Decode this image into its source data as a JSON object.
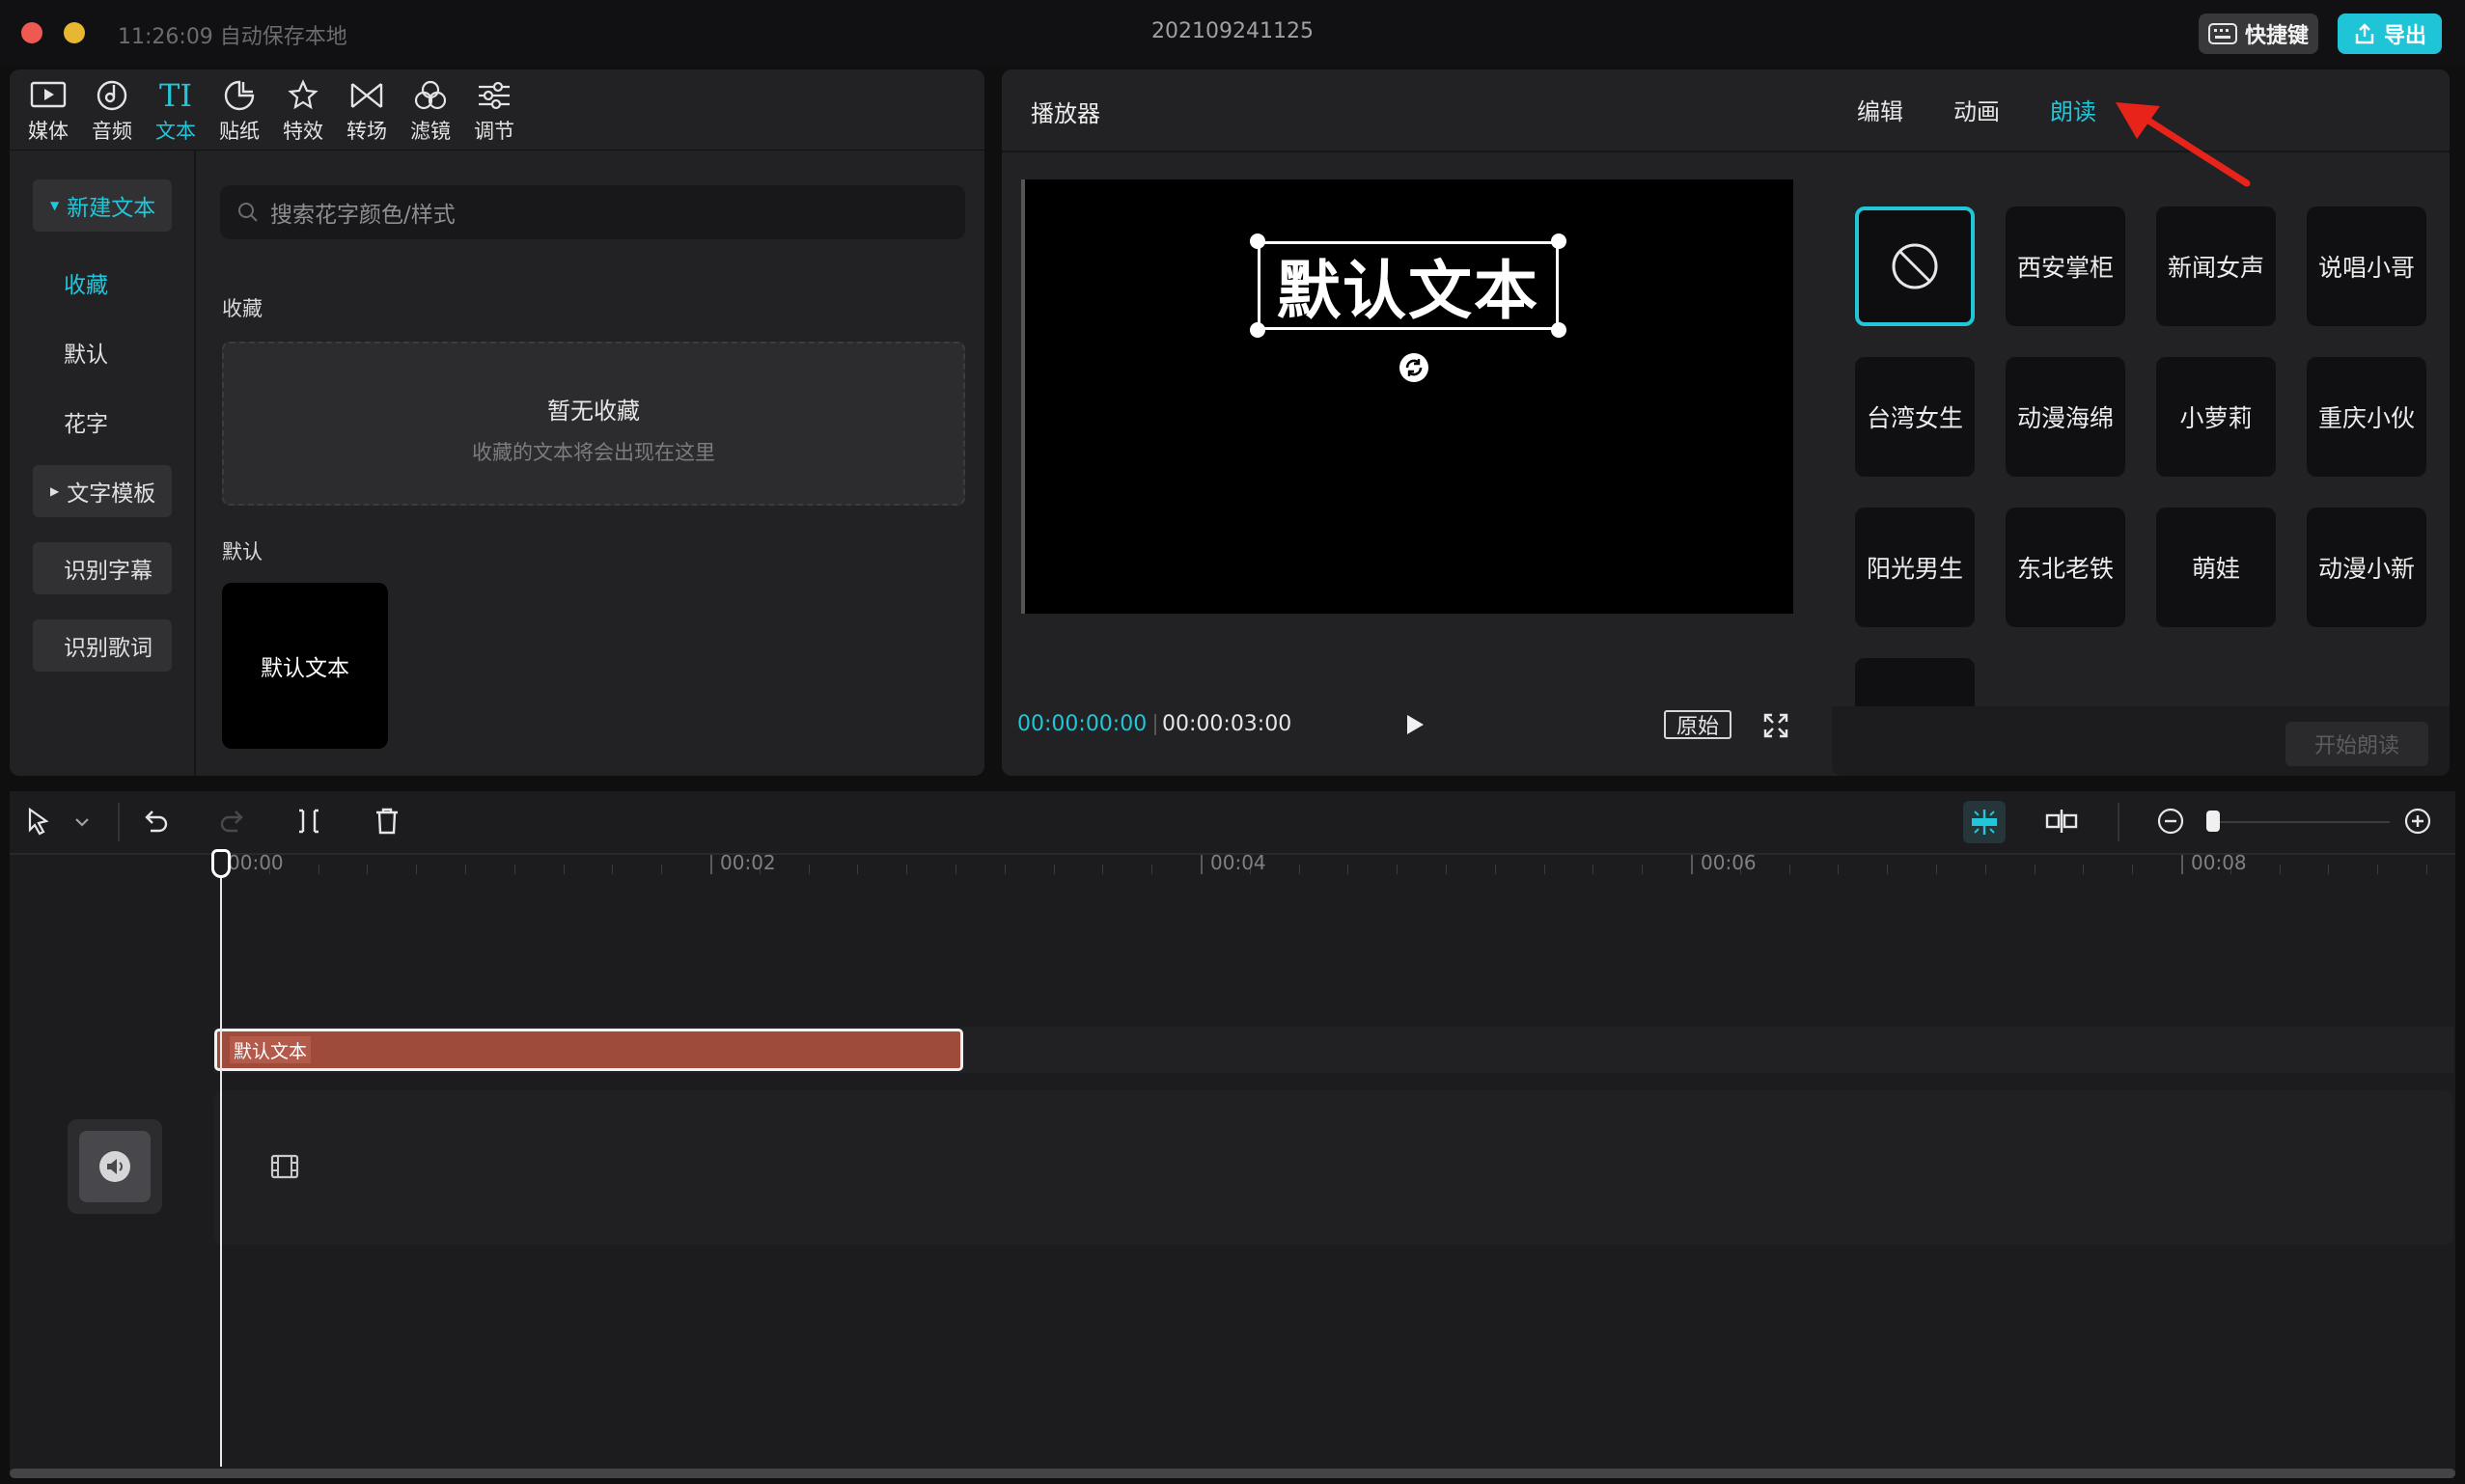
{
  "titlebar": {
    "time_saved": "11:26:09 自动保存本地",
    "project_name": "202109241125",
    "shortcut_label": "快捷键",
    "export_label": "导出"
  },
  "toolbar": {
    "tabs": [
      {
        "label": "媒体",
        "icon": "media-icon"
      },
      {
        "label": "音频",
        "icon": "audio-icon"
      },
      {
        "label": "文本",
        "icon": "text-icon",
        "active": true
      },
      {
        "label": "贴纸",
        "icon": "sticker-icon"
      },
      {
        "label": "特效",
        "icon": "effects-icon"
      },
      {
        "label": "转场",
        "icon": "transition-icon"
      },
      {
        "label": "滤镜",
        "icon": "filter-icon"
      },
      {
        "label": "调节",
        "icon": "adjust-icon"
      }
    ]
  },
  "sidebar": {
    "new_text": "新建文本",
    "favorites": "收藏",
    "default": "默认",
    "fancy": "花字",
    "templates": "文字模板",
    "recognize_subtitles": "识别字幕",
    "recognize_lyrics": "识别歌词"
  },
  "text_panel": {
    "search_placeholder": "搜索花字颜色/样式",
    "favorites_heading": "收藏",
    "empty_title": "暂无收藏",
    "empty_hint": "收藏的文本将会出现在这里",
    "default_heading": "默认",
    "default_card": "默认文本"
  },
  "player": {
    "title": "播放器",
    "overlay_text": "默认文本",
    "current_time": "00:00:00:00",
    "total_time": "00:00:03:00",
    "original_label": "原始"
  },
  "right_panel": {
    "tabs": [
      {
        "label": "编辑"
      },
      {
        "label": "动画"
      },
      {
        "label": "朗读",
        "active": true
      }
    ],
    "voices": [
      "西安掌柜",
      "新闻女声",
      "说唱小哥",
      "台湾女生",
      "动漫海绵",
      "小萝莉",
      "重庆小伙",
      "阳光男生",
      "东北老铁",
      "萌娃",
      "动漫小新"
    ],
    "start_button": "开始朗读",
    "accent_color": "#21c6d8",
    "arrow_color": "#e8231a"
  },
  "timeline": {
    "ticks": [
      "00:00",
      "00:02",
      "00:04",
      "00:06",
      "00:08"
    ],
    "text_clip_label": "默认文本",
    "clip_color": "#9e4b3c"
  }
}
